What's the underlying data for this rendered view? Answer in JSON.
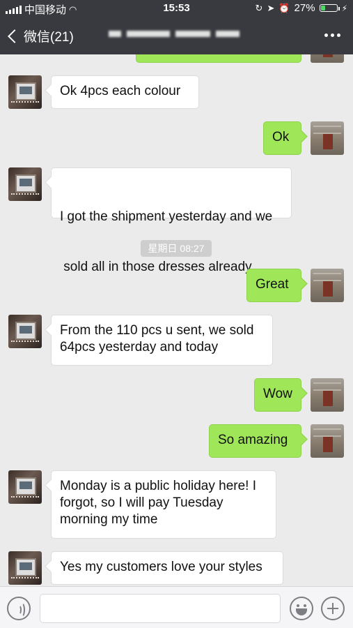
{
  "status_bar": {
    "carrier": "中国移动",
    "time": "15:53",
    "battery": "27%",
    "battery_level": 0.27
  },
  "nav": {
    "back_label": "微信(21)",
    "more_icon": "more-dots-icon"
  },
  "messages": [
    {
      "side": "out",
      "text": ""
    },
    {
      "side": "in",
      "text": "Ok 4pcs each colour"
    },
    {
      "side": "out",
      "text": "Ok"
    },
    {
      "side": "in",
      "lines": [
        "I got the shipment yesterday and we",
        " sold all in those dresses already"
      ]
    },
    {
      "side": "out",
      "text": "Great"
    },
    {
      "side": "in",
      "lines": [
        "From the 110 pcs u sent, we sold",
        "64pcs yesterday and today"
      ]
    },
    {
      "side": "out",
      "text": "Wow"
    },
    {
      "side": "out",
      "text": "So amazing"
    },
    {
      "side": "in",
      "lines": [
        "Monday is a public holiday here! I",
        "forgot, so I will pay Tuesday",
        "morning my time"
      ]
    },
    {
      "side": "in",
      "text": "Yes my customers love your styles"
    }
  ],
  "timestamp": "星期日 08:27",
  "input_bar": {
    "voice_icon": "voice-icon",
    "emoji_icon": "emoji-icon",
    "plus_icon": "plus-icon",
    "text_value": ""
  }
}
